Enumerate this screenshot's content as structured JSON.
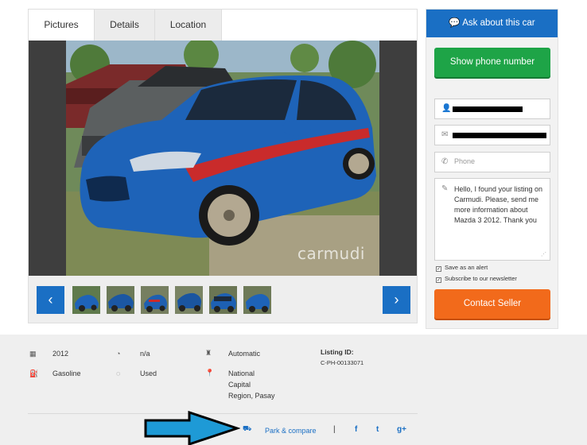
{
  "gallery": {
    "tabs": [
      {
        "label": "Pictures"
      },
      {
        "label": "Details"
      },
      {
        "label": "Location"
      }
    ],
    "watermark": "carmudi",
    "prev_icon": "‹",
    "next_icon": "›"
  },
  "contact": {
    "ask_label": "Ask about this car",
    "ask_icon": "chat-bubbles-icon",
    "show_phone_label": "Show phone number",
    "phone_placeholder": "Phone",
    "message": "Hello, I found your listing on Carmudi. Please, send me more information about Mazda 3 2012. Thank you",
    "save_alert_label": "Save as an alert",
    "newsletter_label": "Subscribe to our newsletter",
    "contact_seller_label": "Contact Seller",
    "check_mark": "✓"
  },
  "specs": {
    "year": "2012",
    "mileage": "n/a",
    "transmission": "Automatic",
    "fuel": "Gasoline",
    "condition": "Used",
    "location_line1": "National",
    "location_line2": "Capital",
    "location_line3": "Region, Pasay",
    "listing_id_label": "Listing ID:",
    "listing_id": "C-PH-00133071"
  },
  "actions": {
    "park_compare_label": "Park & compare",
    "separator": "|",
    "facebook": "f",
    "twitter": "t",
    "gplus": "g+"
  },
  "colors": {
    "primary_blue": "#1a6fc4",
    "green": "#1ea447",
    "orange": "#f26a1b",
    "annotation_arrow": "#1e9ad6"
  }
}
